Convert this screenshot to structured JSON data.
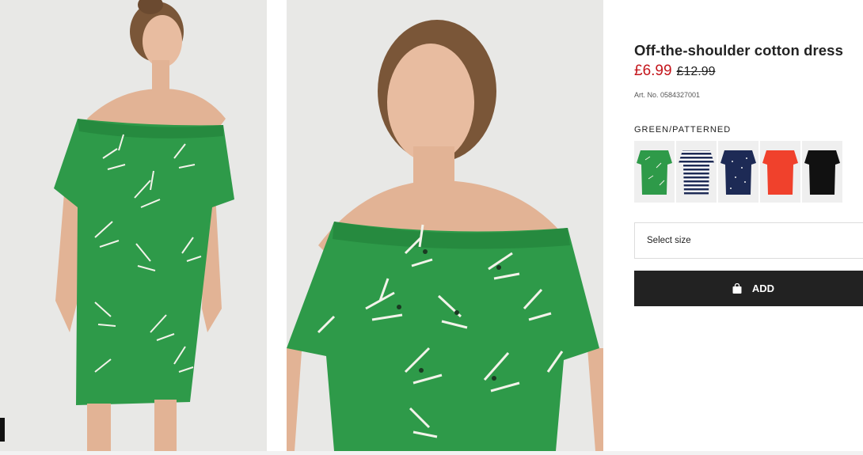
{
  "product": {
    "title": "Off-the-shoulder cotton dress",
    "price_sale": "£6.99",
    "price_original": "£12.99",
    "article_number": "Art. No. 0584327001"
  },
  "colors": {
    "selected_label": "GREEN/PATTERNED",
    "swatches": [
      {
        "name": "green-patterned",
        "color": "#2e9a49"
      },
      {
        "name": "striped",
        "color": "#9aa0aa"
      },
      {
        "name": "navy-dotted",
        "color": "#1d2a55"
      },
      {
        "name": "coral",
        "color": "#f0412c"
      },
      {
        "name": "black",
        "color": "#111111"
      }
    ]
  },
  "actions": {
    "size_placeholder": "Select size",
    "add_label": "ADD"
  },
  "theme": {
    "sale_color": "#c4161c",
    "button_color": "#222222",
    "dress_color": "#2e9a49"
  }
}
